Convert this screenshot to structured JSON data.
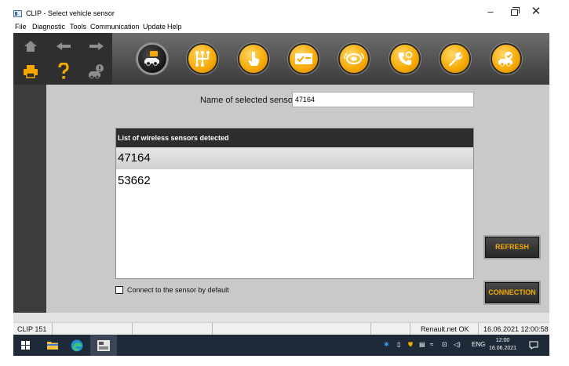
{
  "window": {
    "title": "CLIP - Select vehicle sensor",
    "controls": {
      "minimize": "–",
      "maximize": "",
      "close": "✕"
    }
  },
  "menu": {
    "items": [
      {
        "label": "File"
      },
      {
        "label": "Diagnostic"
      },
      {
        "label": "Tools"
      },
      {
        "label": "Communication"
      },
      {
        "label": "Update"
      },
      {
        "label": "Help"
      }
    ]
  },
  "toolbar": {
    "nav": [
      {
        "icon": "home-icon"
      },
      {
        "icon": "arrow-left-icon"
      },
      {
        "icon": "arrow-right-icon"
      },
      {
        "icon": "printer-icon"
      },
      {
        "icon": "question-icon"
      },
      {
        "icon": "vehicle-warning-icon"
      }
    ],
    "tools": [
      {
        "icon": "vehicle-sensor-icon",
        "active": true
      },
      {
        "icon": "gearbox-icon",
        "active": false
      },
      {
        "icon": "touch-test-icon",
        "active": false
      },
      {
        "icon": "checklist-icon",
        "active": false
      },
      {
        "icon": "tire-sensor-icon",
        "active": false
      },
      {
        "icon": "phone-support-icon",
        "active": false
      },
      {
        "icon": "wrench-icon",
        "active": false
      },
      {
        "icon": "car-tool-icon",
        "active": false
      }
    ],
    "colors": {
      "active_tool": "#151515",
      "tool": "#f6a800"
    }
  },
  "main": {
    "sensor_label": "Name of selected sensor",
    "sensor_value": "47164",
    "list": {
      "header": "List of wireless sensors detected",
      "items": [
        {
          "label": "47164",
          "selected": true
        },
        {
          "label": "53662",
          "selected": false
        }
      ]
    },
    "connect_default": {
      "label": "Connect to the sensor by default",
      "checked": false
    },
    "refresh_label": "REFRESH",
    "connection_label": "CONNECTION",
    "accent_color": "#f2a900"
  },
  "statusbar": {
    "left": "CLIP 151",
    "network": "Renault.net OK",
    "datetime": "16.06.2021 12:00:58"
  },
  "taskbar": {
    "apps": [
      {
        "icon": "windows-start-icon"
      },
      {
        "icon": "file-explorer-icon"
      },
      {
        "icon": "edge-browser-icon"
      },
      {
        "icon": "clip-app-icon",
        "active": true
      }
    ],
    "tray": {
      "language": "ENG",
      "time": "12:00",
      "date": "16.06.2021"
    }
  }
}
